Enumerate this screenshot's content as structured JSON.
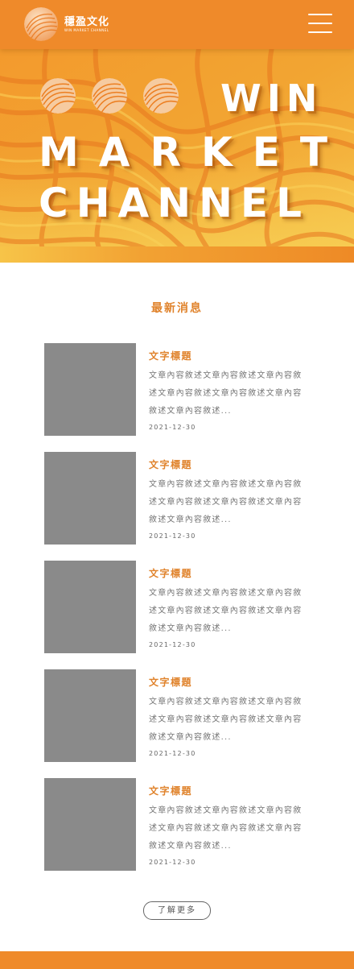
{
  "header": {
    "logo_cn": "穩盈文化",
    "logo_en": "WIN MARKET CHANNEL",
    "menu_icon": "hamburger-menu-icon"
  },
  "hero": {
    "line1": "WIN",
    "line2": "MARKET",
    "line3": "CHANNEL"
  },
  "news": {
    "section_title": "最新消息",
    "items": [
      {
        "title": "文字標題",
        "summary": "文章內容敘述文章內容敘述文章內容敘述文章內容敘述文章內容敘述文章內容敘述文章內容敘述...",
        "date": "2021-12-30"
      },
      {
        "title": "文字標題",
        "summary": "文章內容敘述文章內容敘述文章內容敘述文章內容敘述文章內容敘述文章內容敘述文章內容敘述...",
        "date": "2021-12-30"
      },
      {
        "title": "文字標題",
        "summary": "文章內容敘述文章內容敘述文章內容敘述文章內容敘述文章內容敘述文章內容敘述文章內容敘述...",
        "date": "2021-12-30"
      },
      {
        "title": "文字標題",
        "summary": "文章內容敘述文章內容敘述文章內容敘述文章內容敘述文章內容敘述文章內容敘述文章內容敘述...",
        "date": "2021-12-30"
      },
      {
        "title": "文字標題",
        "summary": "文章內容敘述文章內容敘述文章內容敘述文章內容敘述文章內容敘述文章內容敘述文章內容敘述...",
        "date": "2021-12-30"
      }
    ],
    "more_label": "了解更多"
  },
  "colors": {
    "brand_orange": "#ef8a2a",
    "accent_text": "#e0832c",
    "thumbnail_gray": "#8a8a8a"
  }
}
